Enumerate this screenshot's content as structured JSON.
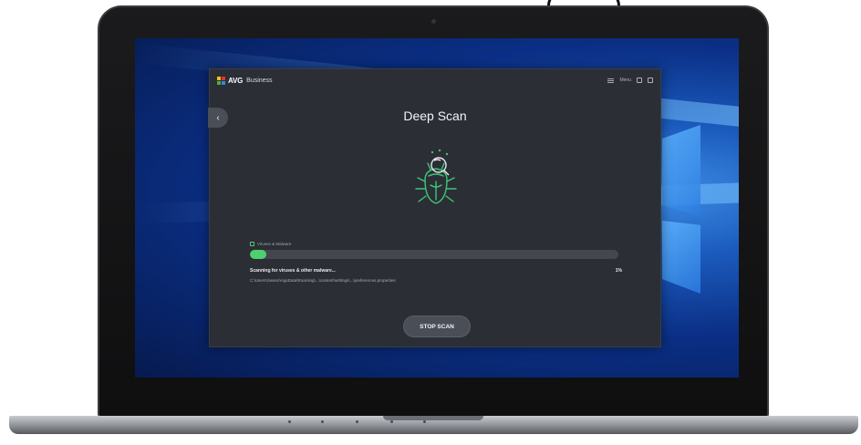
{
  "app": {
    "brand": "AVG",
    "product": "Business",
    "menu_label": "Menu"
  },
  "scan": {
    "title": "Deep Scan",
    "area_label": "Viruses & Malware",
    "progress_percent": 1,
    "percent_label": "1%",
    "status": "Scanning for viruses & other malware...",
    "current_path": "C:\\Users\\Swann\\AppData\\Roaming\\...\\content\\settings\\...\\preferences.properties",
    "stop_label": "STOP SCAN"
  },
  "icons": {
    "back": "chevron-left-icon",
    "bug": "bug-scan-icon",
    "menu": "hamburger-icon"
  },
  "colors": {
    "accent_green": "#4fd06e",
    "window_bg": "#2b2e35",
    "desktop_blue": "#0b2f86"
  }
}
